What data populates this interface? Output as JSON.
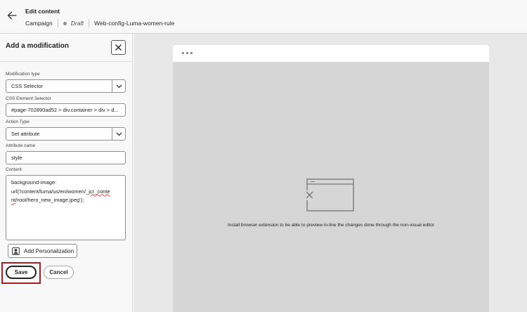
{
  "header": {
    "title": "Edit content",
    "breadcrumb": {
      "section": "Campaign",
      "status": "Draft",
      "name": "Web-config-Luma-women-rule"
    }
  },
  "panel": {
    "title": "Add a modification",
    "fields": {
      "modification_type": {
        "label": "Modification type",
        "value": "CSS Selector"
      },
      "css_selector": {
        "label": "CSS Element Selector",
        "value": "#page-702890ad52 > div.container > div > d..."
      },
      "action_type": {
        "label": "Action Type",
        "value": "Set attribute"
      },
      "attribute_name": {
        "label": "Attribute name",
        "value": "style"
      },
      "content": {
        "label": "Content",
        "line1": "background-image:",
        "line2a": "url('/content/luma/us/en/women/_",
        "line2b": "jcr_conte",
        "line3a": "nt",
        "line3b": "/root/hero_new_image.jpeg');"
      }
    },
    "add_personalization": "Add Personalization",
    "save": "Save",
    "cancel": "Cancel"
  },
  "preview": {
    "message": "Install browser extension to be able to preview in-line the changes done through the non-visual editor"
  },
  "icons": {
    "back": "arrow-left-icon",
    "close": "close-icon",
    "chevron": "chevron-down-icon",
    "personalization": "personalization-icon",
    "browser": "broken-browser-icon"
  },
  "colors": {
    "highlight": "#a52022",
    "canvas": "#d6d6d6"
  }
}
